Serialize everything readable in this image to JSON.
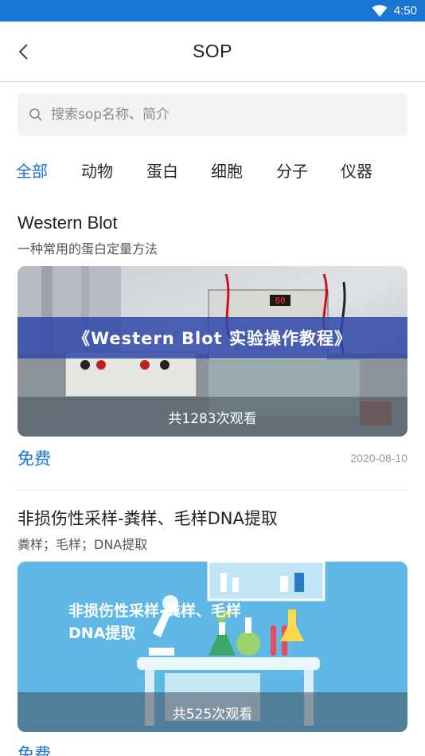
{
  "status_bar": {
    "time": "4:50"
  },
  "header": {
    "title": "SOP"
  },
  "search": {
    "placeholder": "搜索sop名称、简介"
  },
  "tabs": [
    {
      "label": "全部",
      "active": true
    },
    {
      "label": "动物",
      "active": false
    },
    {
      "label": "蛋白",
      "active": false
    },
    {
      "label": "细胞",
      "active": false
    },
    {
      "label": "分子",
      "active": false
    },
    {
      "label": "仪器",
      "active": false
    }
  ],
  "cards": [
    {
      "title": "Western Blot",
      "description": "一种常用的蛋白定量方法",
      "image_banner": "《Western Blot 实验操作教程》",
      "device_display": "80",
      "views": "共1283次观看",
      "price": "免费",
      "date": "2020-08-10"
    },
    {
      "title": "非损伤性采样-粪样、毛样DNA提取",
      "description": "粪样；毛样；DNA提取",
      "image_headline_line1": "非损伤性采样-粪样、毛样",
      "image_headline_line2": "DNA提取",
      "views": "共525次观看",
      "price": "免费"
    }
  ],
  "colors": {
    "accent": "#1a73d4",
    "status_bar": "#1976d2",
    "search_bg": "#f2f3f5"
  }
}
